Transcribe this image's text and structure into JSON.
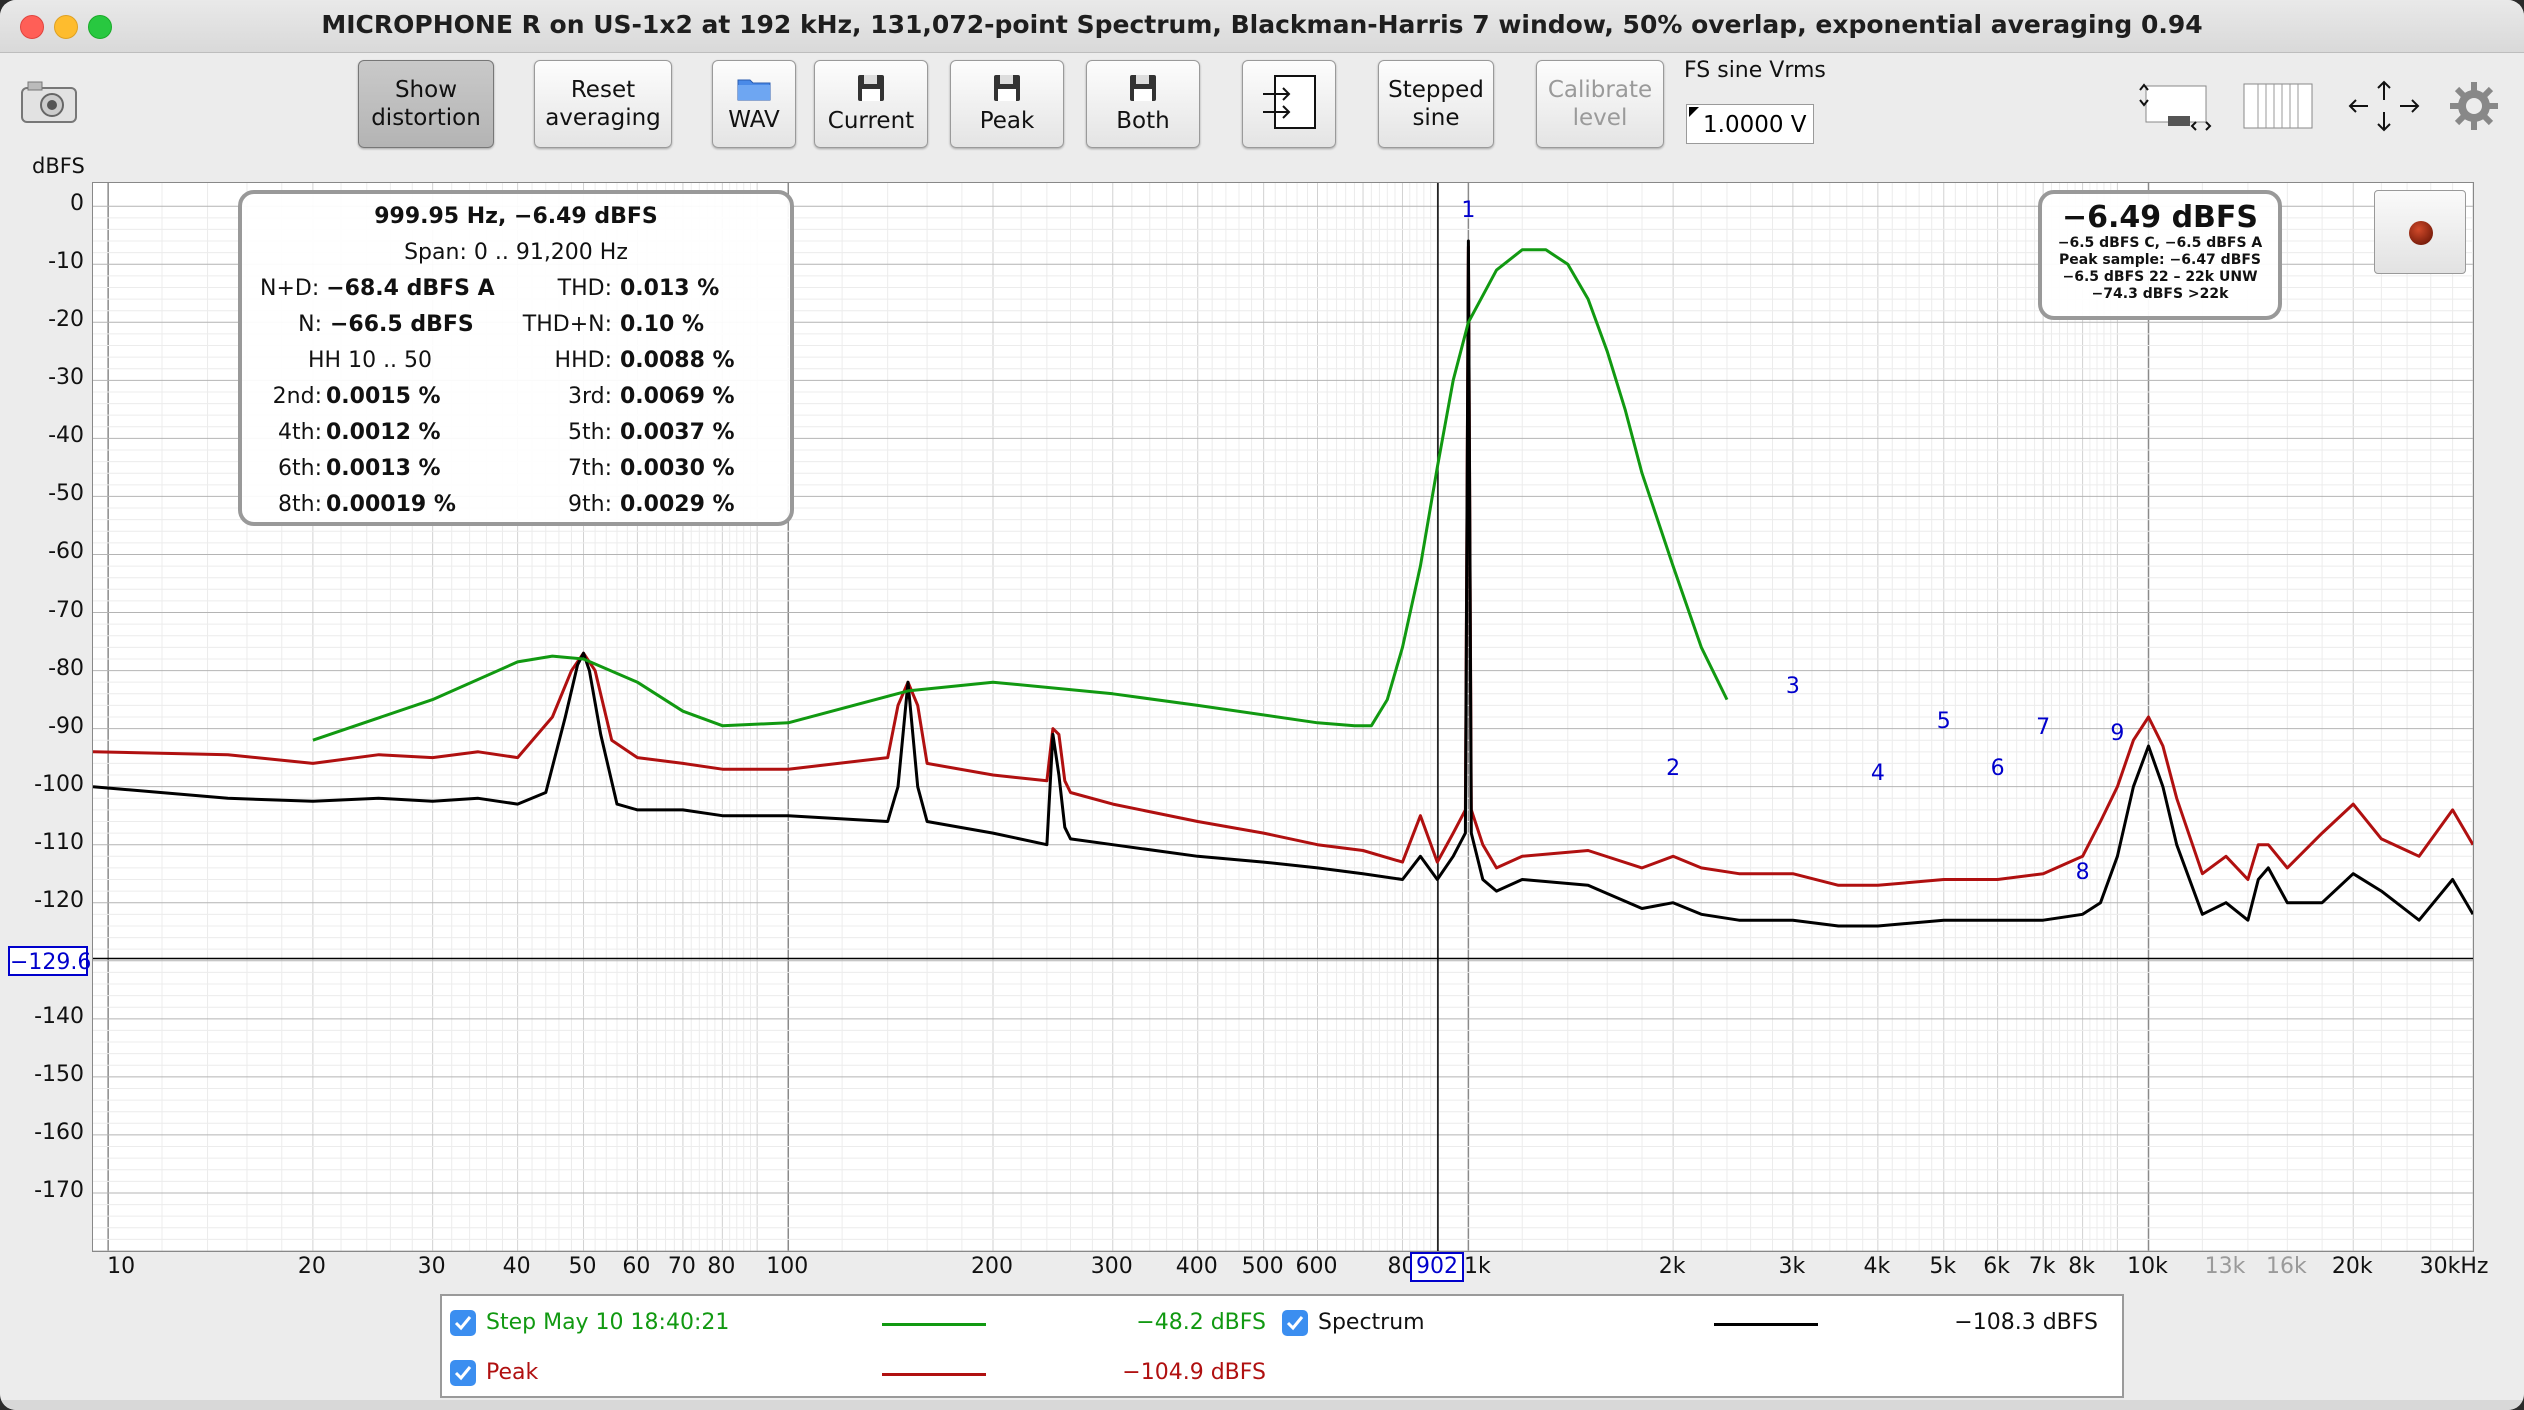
{
  "window": {
    "title": "MICROPHONE R on US-1x2 at 192 kHz, 131,072-point Spectrum, Blackman-Harris 7 window, 50% overlap, exponential averaging 0.94"
  },
  "toolbar": {
    "show_distortion": "Show\ndistortion",
    "reset_averaging": "Reset\naveraging",
    "wav": "WAV",
    "current": "Current",
    "peak": "Peak",
    "both": "Both",
    "stepped_sine": "Stepped\nsine",
    "calibrate_level": "Calibrate\nlevel",
    "fs_label": "FS sine Vrms",
    "fs_value": "1.0000 V"
  },
  "axes": {
    "y_unit": "dBFS",
    "y_ticks": [
      "0",
      "-10",
      "-20",
      "-30",
      "-40",
      "-50",
      "-60",
      "-70",
      "-80",
      "-90",
      "-100",
      "-110",
      "-120",
      "-130",
      "-140",
      "-150",
      "-160",
      "-170"
    ],
    "y_cursor": "−129.6",
    "x_ticks": [
      {
        "label": "10",
        "f": 10
      },
      {
        "label": "20",
        "f": 20
      },
      {
        "label": "30",
        "f": 30
      },
      {
        "label": "40",
        "f": 40
      },
      {
        "label": "50",
        "f": 50
      },
      {
        "label": "60",
        "f": 60
      },
      {
        "label": "70",
        "f": 70
      },
      {
        "label": "80",
        "f": 80
      },
      {
        "label": "100",
        "f": 100
      },
      {
        "label": "200",
        "f": 200
      },
      {
        "label": "300",
        "f": 300
      },
      {
        "label": "400",
        "f": 400
      },
      {
        "label": "500",
        "f": 500
      },
      {
        "label": "600",
        "f": 600
      },
      {
        "label": "80",
        "f": 800
      },
      {
        "label": "2k",
        "f": 2000
      },
      {
        "label": "3k",
        "f": 3000
      },
      {
        "label": "4k",
        "f": 4000
      },
      {
        "label": "5k",
        "f": 5000
      },
      {
        "label": "6k",
        "f": 6000
      },
      {
        "label": "7k",
        "f": 7000
      },
      {
        "label": "8k",
        "f": 8000
      },
      {
        "label": "10k",
        "f": 10000
      },
      {
        "label": "13k",
        "f": 13000,
        "grey": true
      },
      {
        "label": "16k",
        "f": 16000,
        "grey": true
      },
      {
        "label": "20k",
        "f": 20000
      },
      {
        "label": "30kHz",
        "f": 30000
      }
    ],
    "x_cursor": "902",
    "x_after_cursor": "1k"
  },
  "info": {
    "line1": "999.95 Hz, −6.49 dBFS",
    "line2": "Span: 0 .. 91,200 Hz",
    "nd_label": "N+D:",
    "nd_value": "−68.4 dBFS A",
    "thd_label": "THD:",
    "thd_value": "0.013 %",
    "n_label": "N:",
    "n_value": "−66.5 dBFS",
    "thdn_label": "THD+N:",
    "thdn_value": "0.10 %",
    "hh_label": "HH 10 .. 50",
    "hhd_label": "HHD:",
    "hhd_value": "0.0088 %",
    "h2_label": "2nd:",
    "h2_value": "0.0015 %",
    "h3_label": "3rd:",
    "h3_value": "0.0069 %",
    "h4_label": "4th:",
    "h4_value": "0.0012 %",
    "h5_label": "5th:",
    "h5_value": "0.0037 %",
    "h6_label": "6th:",
    "h6_value": "0.0013 %",
    "h7_label": "7th:",
    "h7_value": "0.0030 %",
    "h8_label": "8th:",
    "h8_value": "0.00019 %",
    "h9_label": "9th:",
    "h9_value": "0.0029 %"
  },
  "level": {
    "main": "−6.49 dBFS",
    "l1": "−6.5 dBFS C, −6.5 dBFS A",
    "l2": "Peak sample: −6.47 dBFS",
    "l3": "−6.5 dBFS 22 – 22k UNW",
    "l4": "−74.3 dBFS >22k"
  },
  "legend": {
    "step_label": "Step May 10 18:40:21",
    "step_value": "−48.2 dBFS",
    "spectrum_label": "Spectrum",
    "spectrum_value": "−108.3 dBFS",
    "peak_label": "Peak",
    "peak_value": "−104.9 dBFS"
  },
  "colors": {
    "step": "#119911",
    "peak": "#b01010",
    "spectrum": "#000000",
    "marker": "#0000cc"
  },
  "chart_data": {
    "type": "line",
    "x_scale": "log",
    "xlim": [
      9.5,
      30000
    ],
    "ylim": [
      -180,
      4
    ],
    "harmonic_markers": [
      {
        "label": "1",
        "f": 1000,
        "db": -4
      },
      {
        "label": "2",
        "f": 2000,
        "db": -100
      },
      {
        "label": "3",
        "f": 3000,
        "db": -86
      },
      {
        "label": "4",
        "f": 4000,
        "db": -101
      },
      {
        "label": "5",
        "f": 5000,
        "db": -92
      },
      {
        "label": "6",
        "f": 6000,
        "db": -100
      },
      {
        "label": "7",
        "f": 7000,
        "db": -93
      },
      {
        "label": "8",
        "f": 8000,
        "db": -118
      },
      {
        "label": "9",
        "f": 9000,
        "db": -94
      }
    ],
    "series": [
      {
        "name": "Step May 10 18:40:21",
        "color": "#119911",
        "x": [
          20,
          30,
          40,
          45,
          50,
          60,
          70,
          80,
          100,
          150,
          200,
          300,
          400,
          600,
          680,
          720,
          760,
          800,
          850,
          900,
          950,
          1000,
          1100,
          1200,
          1300,
          1400,
          1500,
          1600,
          1700,
          1800,
          2000,
          2200,
          2400
        ],
        "y": [
          -92,
          -85,
          -78.5,
          -77.5,
          -78,
          -82,
          -87,
          -89.5,
          -89,
          -83.5,
          -82,
          -84,
          -86,
          -89,
          -89.5,
          -89.5,
          -85,
          -76,
          -62,
          -45,
          -30,
          -20,
          -11,
          -7.5,
          -7.5,
          -10,
          -16,
          -25,
          -35,
          -46,
          -62,
          -76,
          -85
        ]
      },
      {
        "name": "Peak",
        "color": "#b01010",
        "x": [
          9.5,
          15,
          20,
          25,
          30,
          35,
          40,
          45,
          48,
          50,
          52,
          55,
          60,
          70,
          80,
          100,
          140,
          145,
          150,
          155,
          160,
          200,
          240,
          245,
          250,
          255,
          260,
          300,
          400,
          500,
          600,
          700,
          800,
          850,
          900,
          950,
          990,
          1000,
          1010,
          1050,
          1100,
          1200,
          1500,
          1800,
          2000,
          2200,
          2500,
          3000,
          3500,
          4000,
          5000,
          6000,
          7000,
          8000,
          8500,
          9000,
          9500,
          10000,
          10500,
          11000,
          12000,
          13000,
          14000,
          14500,
          15000,
          16000,
          18000,
          20000,
          22000,
          25000,
          28000,
          30000
        ],
        "y": [
          -94,
          -94.5,
          -96,
          -94.5,
          -95,
          -94,
          -95,
          -88,
          -80,
          -77,
          -80,
          -92,
          -95,
          -96,
          -97,
          -97,
          -95,
          -86,
          -82,
          -86,
          -96,
          -98,
          -99,
          -90,
          -91,
          -99,
          -101,
          -103,
          -106,
          -108,
          -110,
          -111,
          -113,
          -105,
          -113,
          -108,
          -104,
          -7,
          -104,
          -110,
          -114,
          -112,
          -111,
          -114,
          -112,
          -114,
          -115,
          -115,
          -117,
          -117,
          -116,
          -116,
          -115,
          -112,
          -106,
          -100,
          -92,
          -88,
          -93,
          -102,
          -115,
          -112,
          -116,
          -110,
          -110,
          -114,
          -108,
          -103,
          -109,
          -112,
          -104,
          -110
        ]
      },
      {
        "name": "Spectrum",
        "color": "#000000",
        "x": [
          9.5,
          15,
          20,
          25,
          30,
          35,
          40,
          44,
          47,
          49,
          50,
          51,
          53,
          56,
          60,
          70,
          80,
          100,
          140,
          145,
          150,
          155,
          160,
          200,
          240,
          245,
          250,
          255,
          260,
          300,
          400,
          500,
          600,
          700,
          800,
          850,
          900,
          950,
          990,
          1000,
          1010,
          1050,
          1100,
          1200,
          1500,
          1800,
          2000,
          2200,
          2500,
          3000,
          3500,
          4000,
          5000,
          6000,
          7000,
          8000,
          8500,
          9000,
          9500,
          10000,
          10500,
          11000,
          12000,
          13000,
          14000,
          14500,
          15000,
          16000,
          18000,
          20000,
          22000,
          25000,
          28000,
          30000
        ],
        "y": [
          -100,
          -102,
          -102.5,
          -102,
          -102.5,
          -102,
          -103,
          -101,
          -88,
          -79,
          -77,
          -80,
          -91,
          -103,
          -104,
          -104,
          -105,
          -105,
          -106,
          -100,
          -82,
          -100,
          -106,
          -108,
          -110,
          -91,
          -98,
          -107,
          -109,
          -110,
          -112,
          -113,
          -114,
          -115,
          -116,
          -112,
          -116,
          -112,
          -108,
          -6,
          -108,
          -116,
          -118,
          -116,
          -117,
          -121,
          -120,
          -122,
          -123,
          -123,
          -124,
          -124,
          -123,
          -123,
          -123,
          -122,
          -120,
          -112,
          -100,
          -93,
          -100,
          -110,
          -122,
          -120,
          -123,
          -116,
          -114,
          -120,
          -120,
          -115,
          -118,
          -123,
          -116,
          -122
        ]
      }
    ]
  }
}
